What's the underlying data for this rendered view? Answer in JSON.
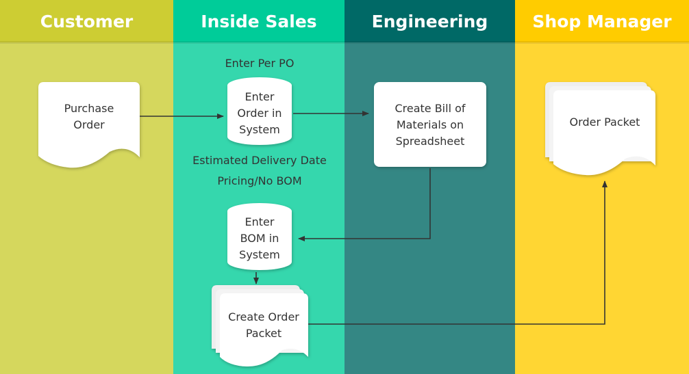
{
  "lanes": [
    {
      "title": "Customer",
      "header_color": "#cdcd33",
      "body_color": "#d5d75d"
    },
    {
      "title": "Inside Sales",
      "header_color": "#00cc99",
      "body_color": "#35d7ad"
    },
    {
      "title": "Engineering",
      "header_color": "#006966",
      "body_color": "#348784"
    },
    {
      "title": "Shop Manager",
      "header_color": "#ffcc00",
      "body_color": "#ffd633"
    }
  ],
  "nodes": {
    "purchase_order": {
      "type": "document",
      "lines": [
        "Purchase",
        "Order"
      ]
    },
    "enter_order": {
      "type": "database",
      "lines": [
        "Enter",
        "Order in",
        "System"
      ]
    },
    "create_bom": {
      "type": "process",
      "lines": [
        "Create Bill of",
        "Materials on",
        "Spreadsheet"
      ]
    },
    "order_packet": {
      "type": "multi-document",
      "lines": [
        "Order Packet"
      ]
    },
    "enter_bom": {
      "type": "database",
      "lines": [
        "Enter",
        "BOM in",
        "System"
      ]
    },
    "create_order_packet": {
      "type": "multi-document",
      "lines": [
        "Create Order",
        "Packet"
      ]
    }
  },
  "annotations": {
    "enter_per_po": "Enter Per PO",
    "estimated_delivery": "Estimated Delivery Date",
    "pricing": "Pricing/No BOM"
  },
  "edges": [
    [
      "purchase_order",
      "enter_order"
    ],
    [
      "enter_order",
      "create_bom"
    ],
    [
      "create_bom",
      "enter_bom"
    ],
    [
      "enter_bom",
      "create_order_packet"
    ],
    [
      "create_order_packet",
      "order_packet"
    ]
  ]
}
